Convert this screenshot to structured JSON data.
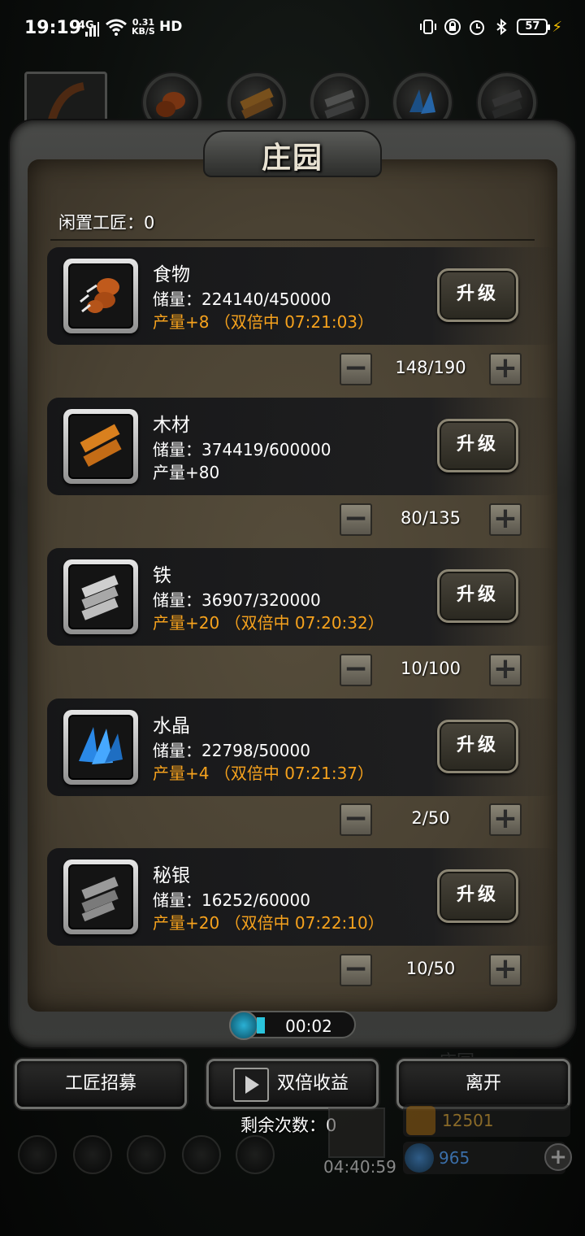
{
  "status_bar": {
    "time": "19:19",
    "network": "4G",
    "speed_value": "0.31",
    "speed_unit": "KB/S",
    "hd": "HD",
    "battery": "57"
  },
  "panel": {
    "title": "庄园",
    "idle_label": "闲置工匠：0"
  },
  "resources": [
    {
      "name": "食物",
      "storage": "储量：224140/450000",
      "production": "产量+8 （双倍中 07:21:03）",
      "boosted": true,
      "upgrade_label": "升级",
      "workers": "148/190",
      "icon": "meat-icon"
    },
    {
      "name": "木材",
      "storage": "储量：374419/600000",
      "production": "产量+80",
      "boosted": false,
      "upgrade_label": "升级",
      "workers": "80/135",
      "icon": "wood-icon"
    },
    {
      "name": "铁",
      "storage": "储量：36907/320000",
      "production": "产量+20 （双倍中 07:20:32）",
      "boosted": true,
      "upgrade_label": "升级",
      "workers": "10/100",
      "icon": "iron-icon"
    },
    {
      "name": "水晶",
      "storage": "储量：22798/50000",
      "production": "产量+4 （双倍中 07:21:37）",
      "boosted": true,
      "upgrade_label": "升级",
      "workers": "2/50",
      "icon": "crystal-icon"
    },
    {
      "name": "秘银",
      "storage": "储量：16252/60000",
      "production": "产量+20 （双倍中 07:22:10）",
      "boosted": true,
      "upgrade_label": "升级",
      "workers": "10/50",
      "icon": "mithril-icon"
    }
  ],
  "stepper": {
    "minus": "−",
    "plus": "+"
  },
  "timer": {
    "value": "00:02"
  },
  "buttons": {
    "recruit": "工匠招募",
    "double": "双倍收益",
    "leave": "离开"
  },
  "remaining": "剩余次数：0",
  "hud": {
    "ghost_title": "庄园",
    "gift_timer": "04:40:59",
    "gold": "12501",
    "gems": "965",
    "plus": "+"
  },
  "colors": {
    "boost": "#f6a21d",
    "panel": "#4a4233",
    "frame": "#3b3c3a"
  }
}
